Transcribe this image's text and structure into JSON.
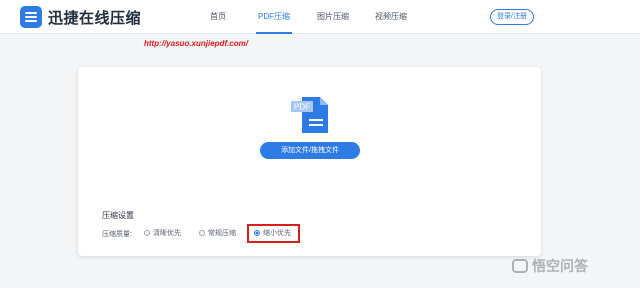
{
  "header": {
    "app_name": "迅捷在线压缩",
    "nav": [
      {
        "label": "首页",
        "active": false
      },
      {
        "label": "PDF压缩",
        "active": true
      },
      {
        "label": "图片压缩",
        "active": false
      },
      {
        "label": "视频压缩",
        "active": false
      }
    ],
    "login_label": "登录/注册"
  },
  "url_text": "http://yasuo.xunjiepdf.com/",
  "upload": {
    "file_badge": "PDF",
    "button_label": "添加文件/拖拽文件"
  },
  "settings": {
    "title": "压缩设置",
    "quality_label": "压缩质量:",
    "options": [
      {
        "label": "清晰优先",
        "selected": false
      },
      {
        "label": "常规压缩",
        "selected": false
      },
      {
        "label": "缩小优先",
        "selected": true
      }
    ]
  },
  "watermark": "悟空问答",
  "colors": {
    "accent": "#2f7be5",
    "highlight_box": "#d91e1e",
    "url_text": "#e0161e"
  }
}
